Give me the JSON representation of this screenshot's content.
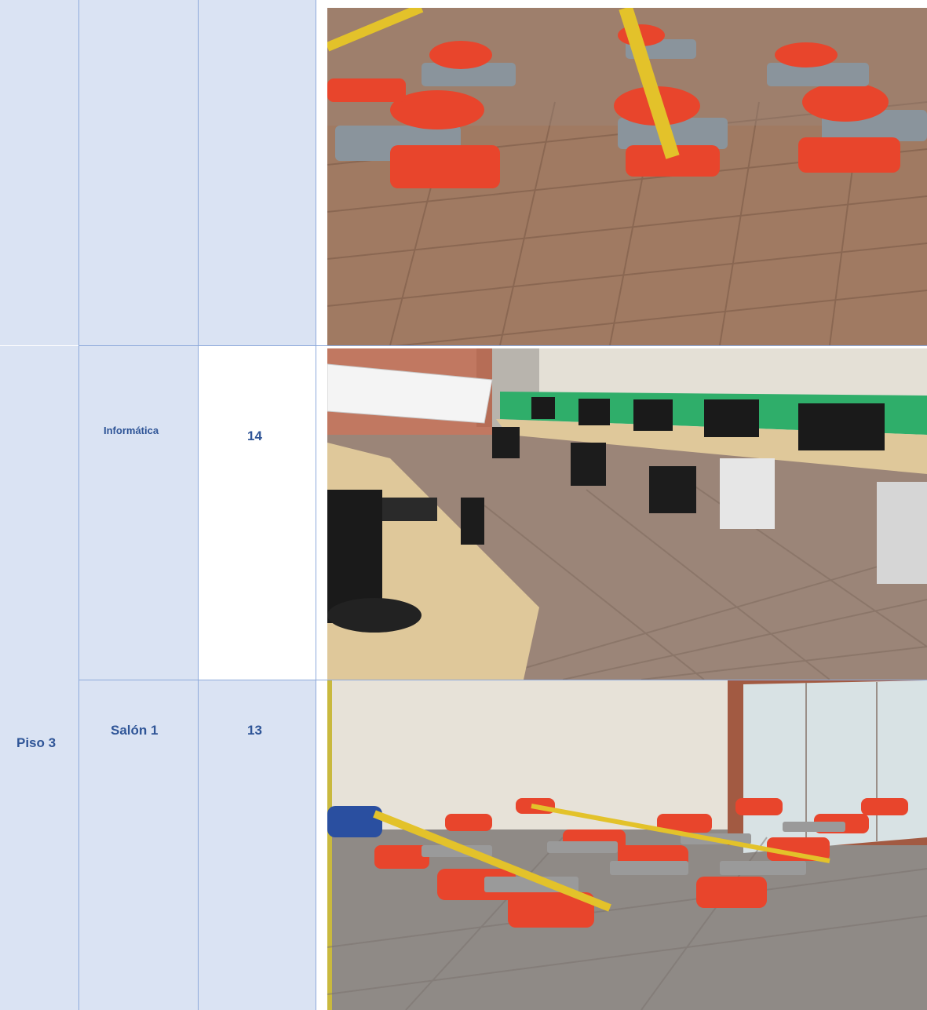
{
  "rows": [
    {
      "floor": "",
      "room": "",
      "count": "",
      "photo": "classroom-desks-icon"
    },
    {
      "floor": "",
      "room": "Informática",
      "count": "14",
      "photo": "computer-lab-icon"
    },
    {
      "floor": "Piso 3",
      "room": "Salón 1",
      "count": "13",
      "photo": "classroom-desks-icon"
    }
  ],
  "colors": {
    "border": "#8eaadb",
    "cell_fill": "#dae3f3",
    "text": "#2f5597",
    "chair": "#e8452c",
    "desk": "#8a949c",
    "floor": "#a07a62",
    "tape": "#e3c22a"
  }
}
